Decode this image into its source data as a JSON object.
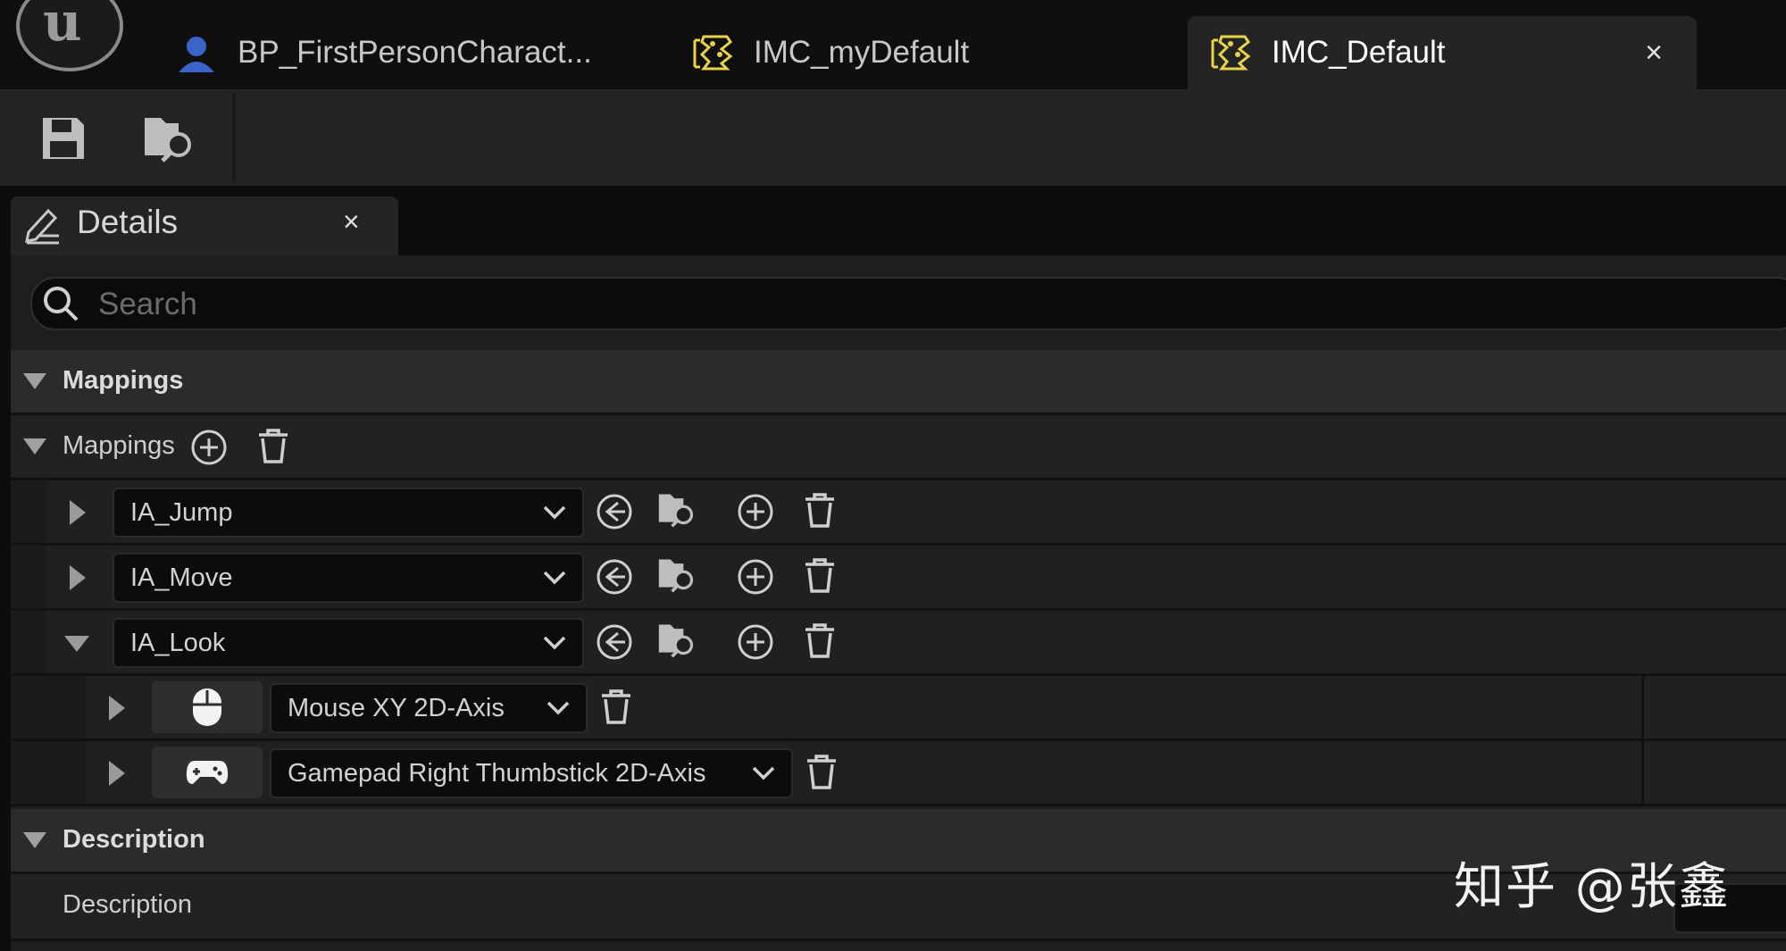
{
  "tabs": [
    {
      "label": "BP_FirstPersonCharact...",
      "icon": "blueprint-character-icon",
      "active": false
    },
    {
      "label": "IMC_myDefault",
      "icon": "input-mapping-context-icon",
      "active": false
    },
    {
      "label": "IMC_Default",
      "icon": "input-mapping-context-icon",
      "active": true
    }
  ],
  "tab_close": "×",
  "logo_letter": "u",
  "toolbar": {
    "save_icon": "save-icon",
    "browse_icon": "browse-folder-icon"
  },
  "details": {
    "title": "Details",
    "close": "×"
  },
  "search": {
    "placeholder": "Search",
    "value": ""
  },
  "sections": {
    "mappings_header": "Mappings",
    "mappings_label": "Mappings",
    "description_header": "Description",
    "description_label": "Description"
  },
  "actions": [
    {
      "name": "IA_Jump",
      "expanded": false
    },
    {
      "name": "IA_Move",
      "expanded": false
    },
    {
      "name": "IA_Look",
      "expanded": true
    }
  ],
  "keys": [
    {
      "device_icon": "mouse-icon",
      "label": "Mouse XY 2D-Axis"
    },
    {
      "device_icon": "gamepad-icon",
      "label": "Gamepad Right Thumbstick 2D-Axis"
    }
  ],
  "watermark": "知乎 @张鑫",
  "colors": {
    "background": "#151515",
    "panel": "#1e1e1e",
    "accent_yellow": "#e8d24a",
    "blue_icon": "#3a64c8"
  }
}
